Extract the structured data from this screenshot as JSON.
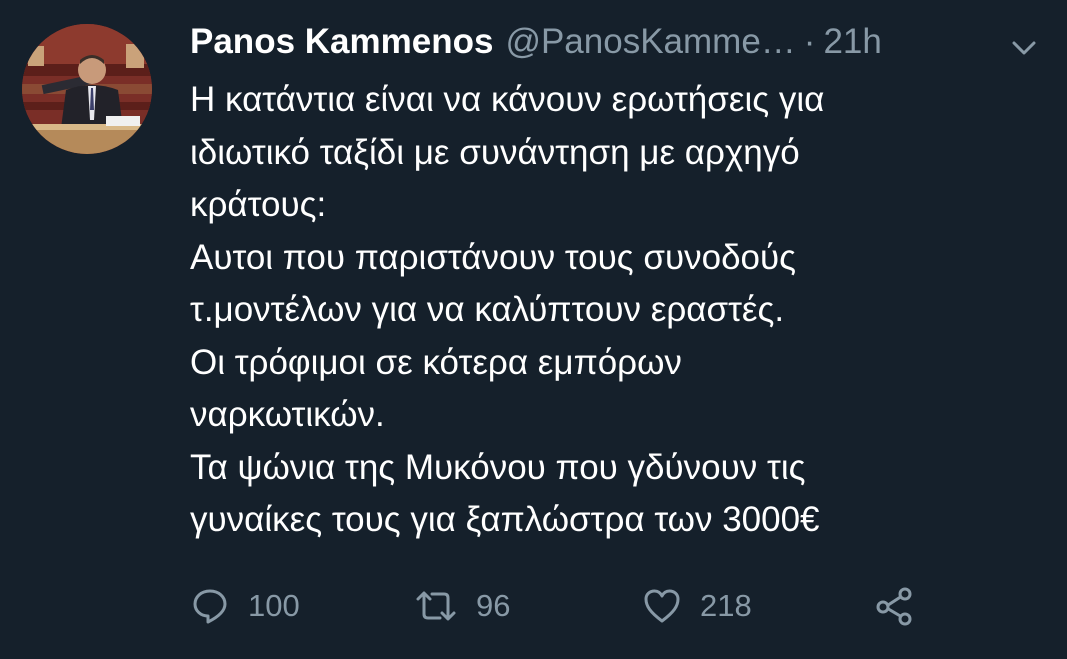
{
  "tweet": {
    "author_name": "Panos Kammenos",
    "author_handle": "@PanosKamme…",
    "separator": "·",
    "timestamp": "21h",
    "text_lines": [
      "Η κατάντια είναι να κάνουν ερωτήσεις για",
      "ιδιωτικό ταξίδι με συνάντηση με αρχηγό",
      "κράτους:",
      "Αυτοι που παριστάνουν τους συνοδούς",
      "τ.μοντέλων για να καλύπτουν εραστές.",
      "Οι τρόφιμοι σε κότερα εμπόρων",
      "ναρκωτικών.",
      "Τα ψώνια της Μυκόνου που γδύνουν τις",
      "γυναίκες τους για ξαπλώστρα των 3000€"
    ],
    "actions": {
      "reply_count": "100",
      "retweet_count": "96",
      "like_count": "218"
    }
  },
  "icons": {
    "menu": "chevron-down-icon",
    "reply": "reply-icon",
    "retweet": "retweet-icon",
    "like": "heart-icon",
    "share": "share-icon"
  },
  "colors": {
    "background": "#15202b",
    "primary_text": "#ffffff",
    "secondary_text": "#8899a6"
  }
}
